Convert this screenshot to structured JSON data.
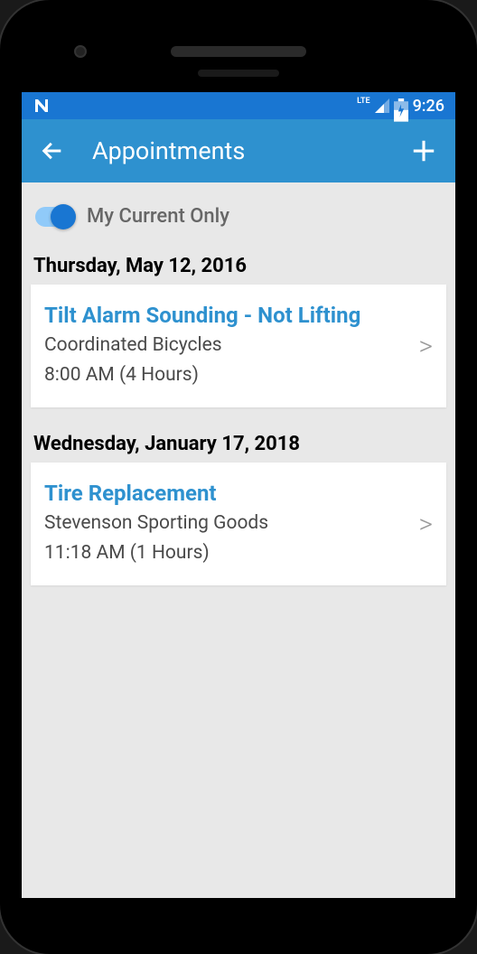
{
  "status": {
    "network": "LTE",
    "time": "9:26"
  },
  "header": {
    "title": "Appointments"
  },
  "filter": {
    "label": "My Current Only",
    "enabled": true
  },
  "sections": [
    {
      "date": "Thursday, May 12, 2016",
      "items": [
        {
          "title": "Tilt Alarm Sounding - Not Lifting",
          "customer": "Coordinated Bicycles",
          "time": "8:00 AM  (4 Hours)"
        }
      ]
    },
    {
      "date": "Wednesday, January 17, 2018",
      "items": [
        {
          "title": "Tire Replacement",
          "customer": "Stevenson Sporting Goods",
          "time": "11:18 AM  (1 Hours)"
        }
      ]
    }
  ]
}
